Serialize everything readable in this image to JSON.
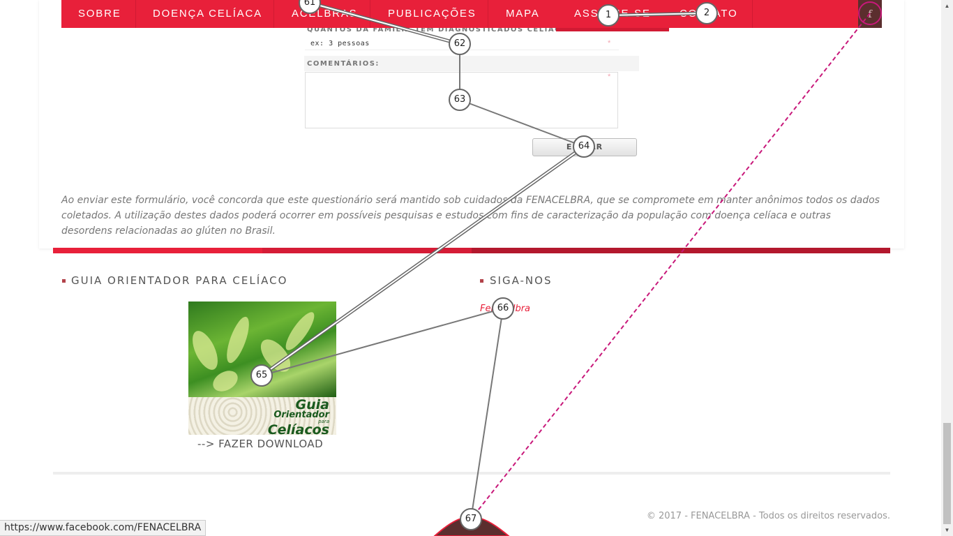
{
  "nav": {
    "items": [
      "SOBRE",
      "DOENÇA CELÍACA",
      "ACELBRAS",
      "PUBLICAÇÕES",
      "MAPA",
      "ASSOCIE-SE",
      "CONTATO"
    ],
    "facebook_glyph": "f"
  },
  "form": {
    "family_question_label": "Quantos da família têm diagnosticados celíacos?",
    "family_input_value": "ex: 3 pessoas",
    "comments_label": "COMENTÁRIOS:",
    "required_star": "*",
    "send_label": "ENVIAR"
  },
  "disclaimer": "Ao enviar este formulário, você concorda que este questionário será mantido sob cuidados da FENACELBRA, que se compromete em manter anônimos todos os dados coletados. A utilização destes dados poderá ocorrer em possíveis pesquisas e estudos com fins de caracterização da população com doença celíaca e outras desordens relacionadas ao glúten no Brasil.",
  "footer": {
    "guide_title": "GUIA ORIENTADOR PARA CELÍACO",
    "guide_image_text": {
      "line1": "Guia",
      "line2": "Orientador",
      "line3": "para",
      "line4": "Celíacos"
    },
    "download_link": "--> FAZER DOWNLOAD",
    "follow_title": "SIGA-NOS",
    "facebook_link": "Fenacelbra",
    "copyright": "© 2017 - FENACELBRA - Todos os direitos reservados."
  },
  "statusbar_url": "https://www.facebook.com/FENACELBRA",
  "markers": [
    "61",
    "62",
    "63",
    "64",
    "65",
    "66",
    "67",
    "1",
    "2"
  ],
  "colors": {
    "nav_red": "#e8203a",
    "band_red": "#c81e34",
    "dashed_line": "#c8187a"
  },
  "icons": {
    "facebook": "facebook-icon",
    "scroll_up": "arrow-up-icon",
    "scroll_down": "arrow-down-icon"
  }
}
